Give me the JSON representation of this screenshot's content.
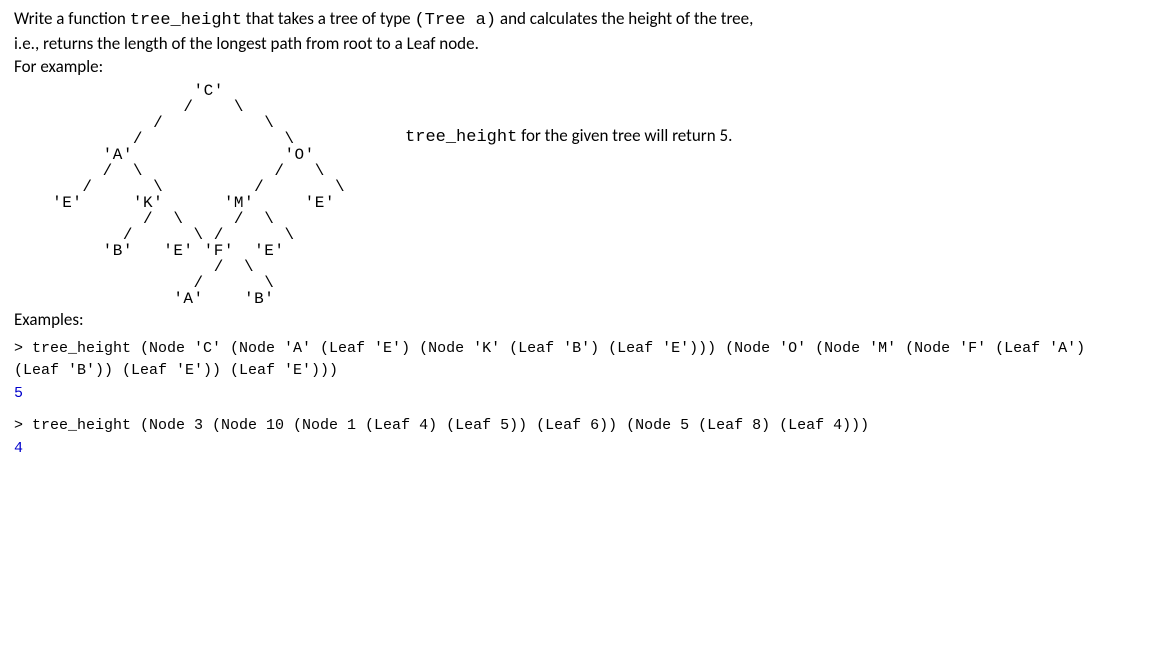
{
  "question": {
    "line1_prefix": "Write a function ",
    "func_name": "tree_height",
    "line1_mid": " that takes a tree of type ",
    "type_expr": "(Tree  a)",
    "line1_suffix": "  and calculates the height of the tree,",
    "line2": "i.e., returns the length of the longest path from root to a Leaf node.",
    "line3": "For example:"
  },
  "tree_diagram": "               'C'\n              /    \\\n           /          \\\n         /              \\\n      'A'               'O'\n      /  \\             /   \\\n    /      \\         /       \\\n 'E'     'K'      'M'     'E'\n          /  \\     /  \\\n        /      \\ /      \\\n      'B'   'E' 'F'  'E'\n                 /  \\\n               /      \\\n             'A'    'B'",
  "tree_caption": {
    "func": "tree_height",
    "mid": " for the given tree will return ",
    "result": "5",
    "suffix": "."
  },
  "examples_heading": "Examples:",
  "examples": [
    {
      "prompt_lines": "> tree_height (Node 'C' (Node 'A' (Leaf 'E') (Node 'K' (Leaf 'B') (Leaf 'E'))) (Node 'O' (Node 'M' (Node 'F' (Leaf 'A') (Leaf 'B')) (Leaf 'E')) (Leaf 'E')))",
      "result": "5"
    },
    {
      "prompt_lines": "> tree_height (Node 3 (Node 10 (Node 1 (Leaf 4) (Leaf 5)) (Leaf 6)) (Node 5 (Leaf 8) (Leaf 4)))",
      "result": "4"
    }
  ]
}
